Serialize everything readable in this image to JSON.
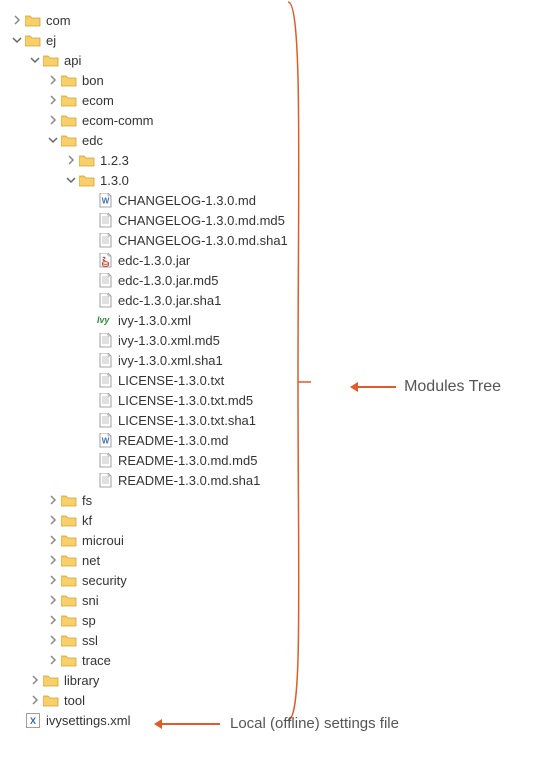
{
  "annotations": {
    "modules_tree": "Modules Tree",
    "settings_file": "Local (offline) settings file"
  },
  "tree": [
    {
      "depth": 0,
      "arrow": "right",
      "icon": "folder",
      "label": "com"
    },
    {
      "depth": 0,
      "arrow": "down",
      "icon": "folder",
      "label": "ej"
    },
    {
      "depth": 1,
      "arrow": "down",
      "icon": "folder",
      "label": "api"
    },
    {
      "depth": 2,
      "arrow": "right",
      "icon": "folder",
      "label": "bon"
    },
    {
      "depth": 2,
      "arrow": "right",
      "icon": "folder",
      "label": "ecom"
    },
    {
      "depth": 2,
      "arrow": "right",
      "icon": "folder",
      "label": "ecom-comm"
    },
    {
      "depth": 2,
      "arrow": "down",
      "icon": "folder",
      "label": "edc"
    },
    {
      "depth": 3,
      "arrow": "right",
      "icon": "folder",
      "label": "1.2.3"
    },
    {
      "depth": 3,
      "arrow": "down",
      "icon": "folder",
      "label": "1.3.0"
    },
    {
      "depth": 4,
      "arrow": "none",
      "icon": "word",
      "label": "CHANGELOG-1.3.0.md"
    },
    {
      "depth": 4,
      "arrow": "none",
      "icon": "file",
      "label": "CHANGELOG-1.3.0.md.md5"
    },
    {
      "depth": 4,
      "arrow": "none",
      "icon": "file",
      "label": "CHANGELOG-1.3.0.md.sha1"
    },
    {
      "depth": 4,
      "arrow": "none",
      "icon": "jar",
      "label": "edc-1.3.0.jar"
    },
    {
      "depth": 4,
      "arrow": "none",
      "icon": "file",
      "label": "edc-1.3.0.jar.md5"
    },
    {
      "depth": 4,
      "arrow": "none",
      "icon": "file",
      "label": "edc-1.3.0.jar.sha1"
    },
    {
      "depth": 4,
      "arrow": "none",
      "icon": "ivy",
      "label": "ivy-1.3.0.xml"
    },
    {
      "depth": 4,
      "arrow": "none",
      "icon": "file",
      "label": "ivy-1.3.0.xml.md5"
    },
    {
      "depth": 4,
      "arrow": "none",
      "icon": "file",
      "label": "ivy-1.3.0.xml.sha1"
    },
    {
      "depth": 4,
      "arrow": "none",
      "icon": "file",
      "label": "LICENSE-1.3.0.txt"
    },
    {
      "depth": 4,
      "arrow": "none",
      "icon": "file",
      "label": "LICENSE-1.3.0.txt.md5"
    },
    {
      "depth": 4,
      "arrow": "none",
      "icon": "file",
      "label": "LICENSE-1.3.0.txt.sha1"
    },
    {
      "depth": 4,
      "arrow": "none",
      "icon": "word",
      "label": "README-1.3.0.md"
    },
    {
      "depth": 4,
      "arrow": "none",
      "icon": "file",
      "label": "README-1.3.0.md.md5"
    },
    {
      "depth": 4,
      "arrow": "none",
      "icon": "file",
      "label": "README-1.3.0.md.sha1"
    },
    {
      "depth": 2,
      "arrow": "right",
      "icon": "folder",
      "label": "fs"
    },
    {
      "depth": 2,
      "arrow": "right",
      "icon": "folder",
      "label": "kf"
    },
    {
      "depth": 2,
      "arrow": "right",
      "icon": "folder",
      "label": "microui"
    },
    {
      "depth": 2,
      "arrow": "right",
      "icon": "folder",
      "label": "net"
    },
    {
      "depth": 2,
      "arrow": "right",
      "icon": "folder",
      "label": "security"
    },
    {
      "depth": 2,
      "arrow": "right",
      "icon": "folder",
      "label": "sni"
    },
    {
      "depth": 2,
      "arrow": "right",
      "icon": "folder",
      "label": "sp"
    },
    {
      "depth": 2,
      "arrow": "right",
      "icon": "folder",
      "label": "ssl"
    },
    {
      "depth": 2,
      "arrow": "right",
      "icon": "folder",
      "label": "trace"
    },
    {
      "depth": 1,
      "arrow": "right",
      "icon": "folder",
      "label": "library"
    },
    {
      "depth": 1,
      "arrow": "right",
      "icon": "folder",
      "label": "tool"
    },
    {
      "depth": 0,
      "arrow": "none",
      "icon": "xml",
      "label": "ivysettings.xml"
    }
  ]
}
